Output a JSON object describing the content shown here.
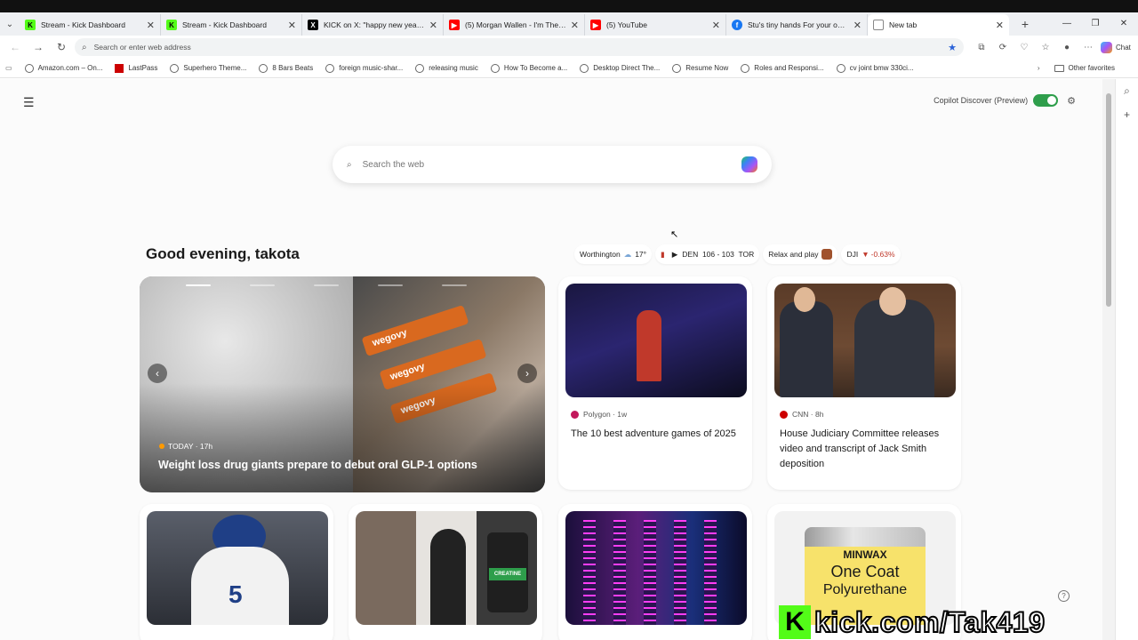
{
  "tabs": [
    {
      "title": "Stream - Kick Dashboard",
      "icon": "kick-icon",
      "color": "#53fc18"
    },
    {
      "title": "Stream - Kick Dashboard",
      "icon": "kick-icon",
      "color": "#53fc18"
    },
    {
      "title": "KICK on X: \"happy new year https:",
      "icon": "x-icon",
      "color": "#000000"
    },
    {
      "title": "(5) Morgan Wallen - I'm The Probl",
      "icon": "youtube-icon",
      "color": "#ff0000"
    },
    {
      "title": "(5) YouTube",
      "icon": "youtube-icon",
      "color": "#ff0000"
    },
    {
      "title": "Stu's tiny hands For your own sor",
      "icon": "facebook-icon",
      "color": "#1877f2"
    },
    {
      "title": "New tab",
      "icon": "newtab-icon",
      "color": "#2a62d8"
    }
  ],
  "addressbar": {
    "placeholder": "Search or enter web address",
    "chat_label": "Chat"
  },
  "bookmarks": [
    "Amazon.com – On...",
    "LastPass",
    "Superhero Theme...",
    "8 Bars Beats",
    "foreign music-shar...",
    "releasing music",
    "How To Become a...",
    "Desktop Direct The...",
    "Resume Now",
    "Roles and Responsi...",
    "cv joint bmw 330ci..."
  ],
  "bookmarks_other": "Other favorites",
  "newtab": {
    "copilot_label": "Copilot Discover (Preview)",
    "search_placeholder": "Search the web",
    "greeting": "Good evening, takota",
    "chips": {
      "weather_city": "Worthington",
      "weather_temp": "17°",
      "score": "DEN  106 - 103  TOR",
      "game": "Relax and play",
      "market_name": "DJI",
      "market_change": "-0.63%"
    },
    "hero": {
      "source": "TODAY · 17h",
      "title": "Weight loss drug giants prepare to debut oral GLP-1 options",
      "pen_label": "wegovy"
    },
    "cards": [
      {
        "source": "Polygon · 1w",
        "title": "The 10 best adventure games of 2025",
        "source_color": "#c2185b"
      },
      {
        "source": "CNN · 8h",
        "title": "House Judiciary Committee releases video and transcript of Jack Smith deposition",
        "source_color": "#cc0000"
      }
    ],
    "bottom_cards": [
      {
        "jersey_number": "5"
      },
      {
        "product_label": "CREATINE"
      },
      {},
      {
        "brand": "MINWAX",
        "line1": "One Coat",
        "line2": "Polyurethane"
      }
    ]
  },
  "watermark": {
    "letter": "K",
    "text": "kick.com/Tak419"
  }
}
